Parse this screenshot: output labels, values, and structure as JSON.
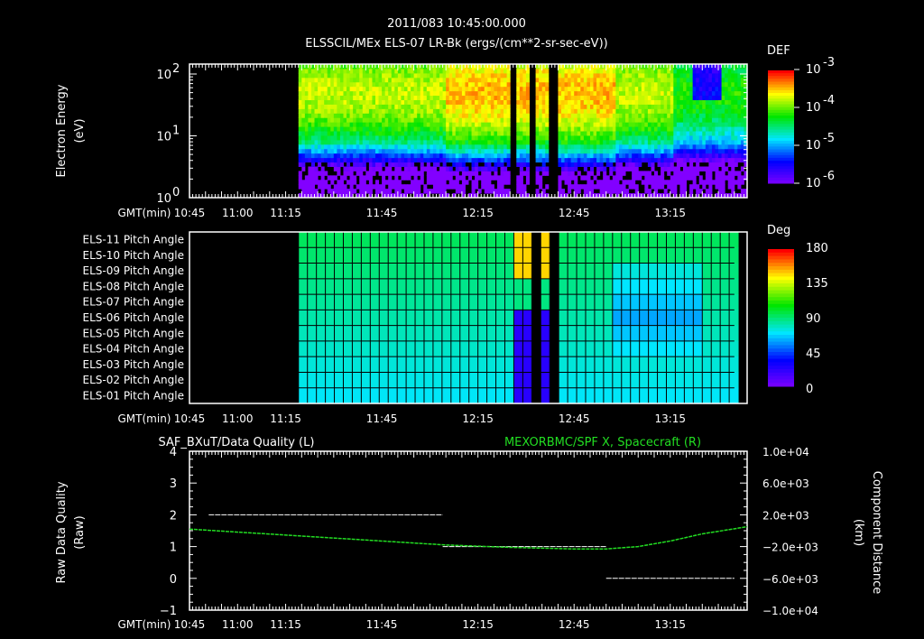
{
  "header": {
    "title": "2011/083 10:45:00.000",
    "subtitle": "ELSSCIL/MEx ELS-07 LR-Bk  (ergs/(cm**2-sr-sec-eV))"
  },
  "chart_data": [
    {
      "type": "heatmap",
      "name": "energy-spectrogram",
      "ylabel": [
        "Electron Energy",
        "(eV)"
      ],
      "yscale": "log",
      "ylim": [
        1,
        150
      ],
      "yticks": [
        {
          "base": "10",
          "exp": "0"
        },
        {
          "base": "10",
          "exp": "1"
        },
        {
          "base": "10",
          "exp": "2"
        }
      ],
      "xlabel": "GMT(min)",
      "xticks": [
        "10:45",
        "11:00",
        "11:15",
        "11:45",
        "12:15",
        "12:45",
        "13:15"
      ],
      "xlim_min": [
        0,
        174
      ],
      "data_start_min": 34,
      "data_end_min": 174,
      "gaps_min": [
        [
          100,
          102
        ],
        [
          106,
          108
        ],
        [
          112,
          115
        ]
      ],
      "colorbar": {
        "label": "DEF",
        "ticks": [
          {
            "base": "10",
            "exp": "-3"
          },
          {
            "base": "10",
            "exp": "-4"
          },
          {
            "base": "10",
            "exp": "-5"
          },
          {
            "base": "10",
            "exp": "-6"
          }
        ],
        "range_log": [
          -6,
          -3
        ]
      },
      "peak_energy_eV": 50,
      "peak_log_def": -3.5
    },
    {
      "type": "heatmap",
      "name": "pitch-angle",
      "rows": [
        "ELS-11 Pitch Angle",
        "ELS-10 Pitch Angle",
        "ELS-09 Pitch Angle",
        "ELS-08 Pitch Angle",
        "ELS-07 Pitch Angle",
        "ELS-06 Pitch Angle",
        "ELS-05 Pitch Angle",
        "ELS-04 Pitch Angle",
        "ELS-03 Pitch Angle",
        "ELS-02 Pitch Angle",
        "ELS-01 Pitch Angle"
      ],
      "xlabel": "GMT(min)",
      "xticks": [
        "10:45",
        "11:00",
        "11:15",
        "11:45",
        "12:15",
        "12:45",
        "13:15"
      ],
      "data_start_min": 34,
      "data_end_min": 170,
      "colorbar": {
        "label": "Deg",
        "ticks": [
          "180",
          "135",
          "90",
          "45",
          "0"
        ],
        "range": [
          0,
          180
        ]
      }
    },
    {
      "type": "line",
      "name": "data-quality-and-x",
      "title_left": "SAF_BXuT/Data Quality (L)",
      "title_right": "MEXORBMC/SPF X, Spacecraft (R)",
      "ylabel_left": [
        "Raw Data Quality",
        "(Raw)"
      ],
      "ylabel_right": [
        "Component Distance",
        "(km)"
      ],
      "yticks_left": [
        "4",
        "3",
        "2",
        "1",
        "0",
        "−1"
      ],
      "ylim_left": [
        -1,
        4
      ],
      "yticks_right": [
        "1.0e+04",
        "6.0e+03",
        "2.0e+03",
        "−2.0e+03",
        "−6.0e+03",
        "−1.0e+04"
      ],
      "ylim_right": [
        -10000,
        10000
      ],
      "xlabel": "GMT(min)",
      "xticks": [
        "10:45",
        "11:00",
        "11:15",
        "11:45",
        "12:15",
        "12:45",
        "13:15"
      ],
      "series": [
        {
          "name": "Data Quality",
          "color": "#ffffff",
          "segments": [
            {
              "x": [
                6,
                79
              ],
              "y": 2
            },
            {
              "x": [
                79,
                130
              ],
              "y": 1
            },
            {
              "x": [
                130,
                170
              ],
              "y": 0
            }
          ]
        },
        {
          "name": "SPF X",
          "color": "#22dd22",
          "x_min": [
            0,
            20,
            40,
            60,
            80,
            100,
            120,
            130,
            140,
            150,
            160,
            174
          ],
          "y_km": [
            200,
            -300,
            -800,
            -1300,
            -1800,
            -2100,
            -2300,
            -2300,
            -2000,
            -1300,
            -400,
            500
          ]
        }
      ]
    }
  ]
}
